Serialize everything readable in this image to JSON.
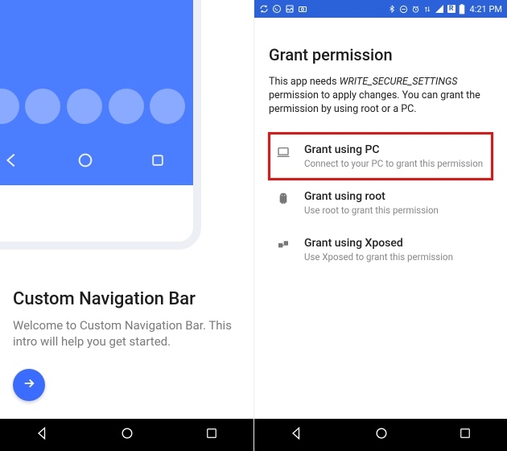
{
  "left": {
    "title": "Custom Navigation Bar",
    "body": "Welcome to Custom Navigation Bar. This intro will help you get started."
  },
  "right": {
    "statusbar": {
      "time": "4:21 PM",
      "net_badge": "R"
    },
    "title": "Grant permission",
    "description_pre": "This app needs ",
    "description_perm": "WRITE_SECURE_SETTINGS",
    "description_post": " permission to apply changes. You can grant the permission by using root or a PC.",
    "options": {
      "pc": {
        "title": "Grant using PC",
        "sub": "Connect to your PC to grant this permission"
      },
      "root": {
        "title": "Grant using root",
        "sub": "Use root to grant this permission"
      },
      "xposed": {
        "title": "Grant using Xposed",
        "sub": "Use Xposed to grant this permission"
      }
    }
  }
}
